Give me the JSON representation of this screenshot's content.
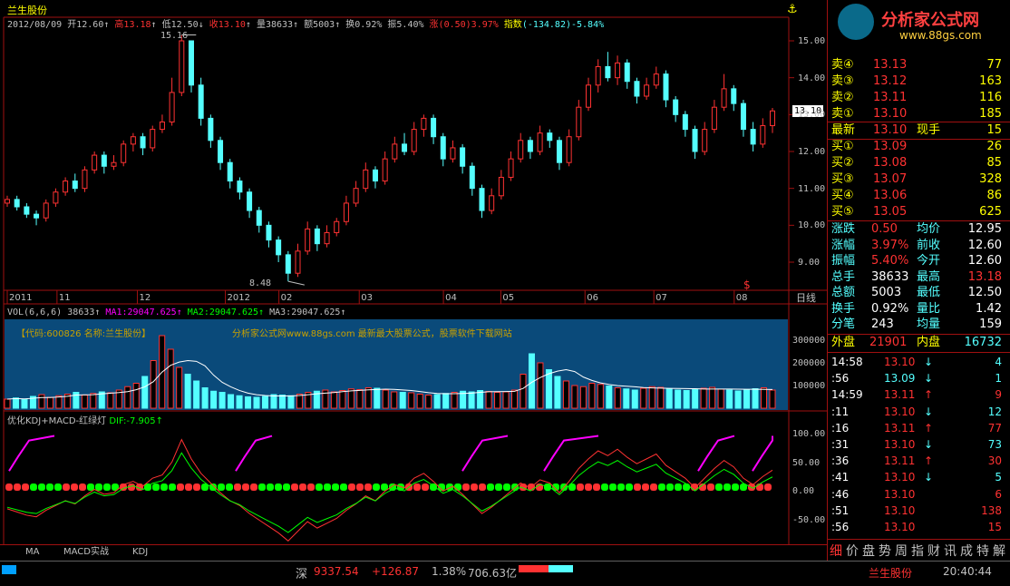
{
  "header": {
    "stock_name": "兰生股份",
    "date": "2012/08/09",
    "open_label": "开",
    "open_value": "12.60",
    "high_label": "高",
    "high_value": "13.18",
    "low_label": "低",
    "low_value": "12.50",
    "close_label": "收",
    "close_value": "13.10",
    "volume_label": "量",
    "volume_value": "38633",
    "amount_label": "额",
    "amount_value": "5003",
    "turnover_label": "换",
    "turnover_value": "0.92%",
    "amplitude_label": "振",
    "amplitude_value": "5.40%",
    "change_label": "涨",
    "change_value": "(0.50)3.97%",
    "index_label": "指数",
    "index_value": "(-134.82)-5.84%"
  },
  "price_chart": {
    "high_mark": "15.16",
    "low_mark": "8.48",
    "current_price_tag": "13.10",
    "y_ticks": [
      "15.00",
      "14.00",
      "13.00",
      "12.00",
      "11.00",
      "10.00",
      "9.00"
    ],
    "x_labels": [
      "2011",
      "11",
      "12",
      "2012",
      "02",
      "03",
      "04",
      "05",
      "06",
      "07",
      "08"
    ],
    "period_label": "日线",
    "candles": [
      {
        "o": 10.6,
        "c": 10.7,
        "h": 10.8,
        "l": 10.5
      },
      {
        "o": 10.7,
        "c": 10.5,
        "h": 10.8,
        "l": 10.4
      },
      {
        "o": 10.5,
        "c": 10.3,
        "h": 10.6,
        "l": 10.2
      },
      {
        "o": 10.3,
        "c": 10.2,
        "h": 10.4,
        "l": 10.0
      },
      {
        "o": 10.2,
        "c": 10.6,
        "h": 10.7,
        "l": 10.1
      },
      {
        "o": 10.6,
        "c": 10.9,
        "h": 11.0,
        "l": 10.5
      },
      {
        "o": 10.9,
        "c": 11.2,
        "h": 11.3,
        "l": 10.8
      },
      {
        "o": 11.2,
        "c": 11.0,
        "h": 11.4,
        "l": 10.9
      },
      {
        "o": 11.0,
        "c": 11.5,
        "h": 11.6,
        "l": 10.9
      },
      {
        "o": 11.5,
        "c": 11.9,
        "h": 12.0,
        "l": 11.4
      },
      {
        "o": 11.9,
        "c": 11.6,
        "h": 12.0,
        "l": 11.4
      },
      {
        "o": 11.6,
        "c": 11.7,
        "h": 11.9,
        "l": 11.5
      },
      {
        "o": 11.7,
        "c": 12.2,
        "h": 12.3,
        "l": 11.6
      },
      {
        "o": 12.2,
        "c": 12.4,
        "h": 12.5,
        "l": 12.0
      },
      {
        "o": 12.4,
        "c": 12.1,
        "h": 12.5,
        "l": 11.9
      },
      {
        "o": 12.1,
        "c": 12.6,
        "h": 12.7,
        "l": 12.0
      },
      {
        "o": 12.6,
        "c": 12.8,
        "h": 13.0,
        "l": 12.5
      },
      {
        "o": 12.8,
        "c": 13.6,
        "h": 14.0,
        "l": 12.7
      },
      {
        "o": 13.6,
        "c": 15.0,
        "h": 15.16,
        "l": 13.5
      },
      {
        "o": 15.0,
        "c": 13.8,
        "h": 15.0,
        "l": 13.6
      },
      {
        "o": 13.8,
        "c": 12.9,
        "h": 14.0,
        "l": 12.7
      },
      {
        "o": 12.9,
        "c": 12.3,
        "h": 13.0,
        "l": 12.1
      },
      {
        "o": 12.3,
        "c": 11.7,
        "h": 12.4,
        "l": 11.5
      },
      {
        "o": 11.7,
        "c": 11.2,
        "h": 11.8,
        "l": 11.0
      },
      {
        "o": 11.2,
        "c": 10.9,
        "h": 11.3,
        "l": 10.7
      },
      {
        "o": 10.9,
        "c": 10.4,
        "h": 11.0,
        "l": 10.2
      },
      {
        "o": 10.4,
        "c": 10.0,
        "h": 10.5,
        "l": 9.8
      },
      {
        "o": 10.0,
        "c": 9.6,
        "h": 10.1,
        "l": 9.4
      },
      {
        "o": 9.6,
        "c": 9.2,
        "h": 9.7,
        "l": 9.0
      },
      {
        "o": 9.2,
        "c": 8.7,
        "h": 9.3,
        "l": 8.48
      },
      {
        "o": 8.7,
        "c": 9.3,
        "h": 9.5,
        "l": 8.6
      },
      {
        "o": 9.3,
        "c": 9.9,
        "h": 10.1,
        "l": 9.2
      },
      {
        "o": 9.9,
        "c": 9.5,
        "h": 10.0,
        "l": 9.3
      },
      {
        "o": 9.5,
        "c": 9.8,
        "h": 10.0,
        "l": 9.4
      },
      {
        "o": 9.8,
        "c": 10.1,
        "h": 10.2,
        "l": 9.7
      },
      {
        "o": 10.1,
        "c": 10.6,
        "h": 10.8,
        "l": 10.0
      },
      {
        "o": 10.6,
        "c": 11.0,
        "h": 11.2,
        "l": 10.5
      },
      {
        "o": 11.0,
        "c": 11.5,
        "h": 11.7,
        "l": 10.9
      },
      {
        "o": 11.5,
        "c": 11.2,
        "h": 11.6,
        "l": 11.0
      },
      {
        "o": 11.2,
        "c": 11.8,
        "h": 12.0,
        "l": 11.1
      },
      {
        "o": 11.8,
        "c": 12.2,
        "h": 12.4,
        "l": 11.7
      },
      {
        "o": 12.2,
        "c": 12.0,
        "h": 12.5,
        "l": 11.9
      },
      {
        "o": 12.0,
        "c": 12.6,
        "h": 12.8,
        "l": 11.9
      },
      {
        "o": 12.6,
        "c": 12.9,
        "h": 13.0,
        "l": 12.4
      },
      {
        "o": 12.9,
        "c": 12.4,
        "h": 13.0,
        "l": 12.2
      },
      {
        "o": 12.4,
        "c": 11.8,
        "h": 12.5,
        "l": 11.6
      },
      {
        "o": 11.8,
        "c": 12.1,
        "h": 12.3,
        "l": 11.7
      },
      {
        "o": 12.1,
        "c": 11.6,
        "h": 12.2,
        "l": 11.4
      },
      {
        "o": 11.6,
        "c": 11.0,
        "h": 11.7,
        "l": 10.8
      },
      {
        "o": 11.0,
        "c": 10.4,
        "h": 11.1,
        "l": 10.2
      },
      {
        "o": 10.4,
        "c": 10.8,
        "h": 11.0,
        "l": 10.3
      },
      {
        "o": 10.8,
        "c": 11.3,
        "h": 11.5,
        "l": 10.7
      },
      {
        "o": 11.3,
        "c": 11.8,
        "h": 12.0,
        "l": 11.2
      },
      {
        "o": 11.8,
        "c": 12.3,
        "h": 12.5,
        "l": 11.7
      },
      {
        "o": 12.3,
        "c": 12.0,
        "h": 12.4,
        "l": 11.8
      },
      {
        "o": 12.0,
        "c": 12.5,
        "h": 12.7,
        "l": 11.9
      },
      {
        "o": 12.5,
        "c": 12.3,
        "h": 12.6,
        "l": 12.1
      },
      {
        "o": 12.3,
        "c": 11.7,
        "h": 12.4,
        "l": 11.5
      },
      {
        "o": 11.7,
        "c": 12.4,
        "h": 12.6,
        "l": 11.6
      },
      {
        "o": 12.4,
        "c": 13.2,
        "h": 13.4,
        "l": 12.3
      },
      {
        "o": 13.2,
        "c": 13.8,
        "h": 14.0,
        "l": 13.1
      },
      {
        "o": 13.8,
        "c": 14.3,
        "h": 14.5,
        "l": 13.6
      },
      {
        "o": 14.3,
        "c": 14.0,
        "h": 14.7,
        "l": 13.9
      },
      {
        "o": 14.0,
        "c": 14.4,
        "h": 14.6,
        "l": 13.8
      },
      {
        "o": 14.4,
        "c": 13.9,
        "h": 14.5,
        "l": 13.7
      },
      {
        "o": 13.9,
        "c": 13.5,
        "h": 14.0,
        "l": 13.3
      },
      {
        "o": 13.5,
        "c": 13.8,
        "h": 14.0,
        "l": 13.4
      },
      {
        "o": 13.8,
        "c": 14.1,
        "h": 14.3,
        "l": 13.7
      },
      {
        "o": 14.1,
        "c": 13.4,
        "h": 14.2,
        "l": 13.2
      },
      {
        "o": 13.4,
        "c": 13.0,
        "h": 13.5,
        "l": 12.8
      },
      {
        "o": 13.0,
        "c": 12.6,
        "h": 13.1,
        "l": 12.4
      },
      {
        "o": 12.6,
        "c": 12.0,
        "h": 12.7,
        "l": 11.8
      },
      {
        "o": 12.0,
        "c": 12.6,
        "h": 12.8,
        "l": 11.9
      },
      {
        "o": 12.6,
        "c": 13.2,
        "h": 13.4,
        "l": 12.5
      },
      {
        "o": 13.2,
        "c": 13.7,
        "h": 14.1,
        "l": 13.1
      },
      {
        "o": 13.7,
        "c": 13.3,
        "h": 13.8,
        "l": 13.1
      },
      {
        "o": 13.3,
        "c": 12.6,
        "h": 13.4,
        "l": 12.4
      },
      {
        "o": 12.6,
        "c": 12.2,
        "h": 12.8,
        "l": 12.0
      },
      {
        "o": 12.2,
        "c": 12.7,
        "h": 12.9,
        "l": 12.1
      },
      {
        "o": 12.7,
        "c": 13.1,
        "h": 13.18,
        "l": 12.5
      }
    ]
  },
  "volume_panel": {
    "title": "VOL(6,6,6)",
    "vol_value": "38633",
    "ma1": "MA1:29047.625",
    "ma2": "MA2:29047.625",
    "ma3": "MA3:29047.625",
    "info_code": "【代码:600826  名称:兰生股份】",
    "watermark": "分析家公式网www.88gs.com 最新最大股票公式，股票软件下载网站",
    "y_ticks": [
      "300000",
      "200000",
      "100000"
    ],
    "values": [
      40,
      45,
      38,
      52,
      60,
      48,
      55,
      62,
      70,
      58,
      65,
      72,
      68,
      80,
      95,
      110,
      140,
      210,
      320,
      260,
      180,
      150,
      120,
      90,
      75,
      70,
      60,
      55,
      50,
      48,
      52,
      60,
      58,
      55,
      62,
      70,
      75,
      80,
      72,
      78,
      85,
      82,
      90,
      88,
      80,
      72,
      70,
      68,
      62,
      58,
      60,
      65,
      70,
      75,
      72,
      78,
      74,
      70,
      72,
      80,
      150,
      240,
      200,
      170,
      140,
      120,
      100,
      95,
      110,
      105,
      98,
      90,
      85,
      80,
      88,
      95,
      92,
      86,
      80,
      78,
      84,
      88,
      92,
      84,
      80,
      76,
      82,
      86,
      90,
      80
    ]
  },
  "indicator_panel": {
    "title": "优化KDJ+MACD-红绿灯",
    "dif_label": "DIF:-7.905",
    "y_ticks": [
      "100.00",
      "50.00",
      "0.00",
      "-50.00"
    ]
  },
  "bottom_tabs": [
    "MA",
    "MACD实战",
    "KDJ"
  ],
  "logo": {
    "brand": "分析家公式网",
    "url": "www.88gs.com"
  },
  "quote": {
    "sell_rows": [
      {
        "label": "卖④",
        "price": "13.13",
        "vol": "77"
      },
      {
        "label": "卖③",
        "price": "13.12",
        "vol": "163"
      },
      {
        "label": "卖②",
        "price": "13.11",
        "vol": "116"
      },
      {
        "label": "卖①",
        "price": "13.10",
        "vol": "185"
      }
    ],
    "latest_label": "最新",
    "latest_price": "13.10",
    "now_label": "现手",
    "now_vol": "15",
    "buy_rows": [
      {
        "label": "买①",
        "price": "13.09",
        "vol": "26"
      },
      {
        "label": "买②",
        "price": "13.08",
        "vol": "85"
      },
      {
        "label": "买③",
        "price": "13.07",
        "vol": "328"
      },
      {
        "label": "买④",
        "price": "13.06",
        "vol": "86"
      },
      {
        "label": "买⑤",
        "price": "13.05",
        "vol": "625"
      }
    ],
    "stats": [
      {
        "l1": "涨跌",
        "v1": "0.50",
        "l2": "均价",
        "v2": "12.95"
      },
      {
        "l1": "涨幅",
        "v1": "3.97%",
        "l2": "前收",
        "v2": "12.60"
      },
      {
        "l1": "振幅",
        "v1": "5.40%",
        "l2": "今开",
        "v2": "12.60"
      },
      {
        "l1": "总手",
        "v1": "38633",
        "l2": "最高",
        "v2": "13.18"
      },
      {
        "l1": "总额",
        "v1": "5003",
        "l2": "最低",
        "v2": "12.50"
      },
      {
        "l1": "换手",
        "v1": "0.92%",
        "l2": "量比",
        "v2": "1.42"
      },
      {
        "l1": "分笔",
        "v1": "243",
        "l2": "均量",
        "v2": "159"
      }
    ],
    "outer_label": "外盘",
    "outer_value": "21901",
    "inner_label": "内盘",
    "inner_value": "16732"
  },
  "ticks": [
    {
      "time": "14:58",
      "price": "13.10",
      "dir": "down",
      "vol": "4"
    },
    {
      "time": ":56",
      "price": "13.09",
      "dir": "down",
      "vol": "1"
    },
    {
      "time": "14:59",
      "price": "13.11",
      "dir": "up",
      "vol": "9"
    },
    {
      "time": ":11",
      "price": "13.10",
      "dir": "down",
      "vol": "12"
    },
    {
      "time": ":16",
      "price": "13.11",
      "dir": "up",
      "vol": "77"
    },
    {
      "time": ":31",
      "price": "13.10",
      "dir": "down",
      "vol": "73"
    },
    {
      "time": ":36",
      "price": "13.11",
      "dir": "up",
      "vol": "30"
    },
    {
      "time": ":41",
      "price": "13.10",
      "dir": "down",
      "vol": "5"
    },
    {
      "time": ":46",
      "price": "13.10",
      "dir": "",
      "vol": "6"
    },
    {
      "time": ":51",
      "price": "13.10",
      "dir": "",
      "vol": "138"
    },
    {
      "time": ":56",
      "price": "13.10",
      "dir": "",
      "vol": "15"
    }
  ],
  "right_tabs": [
    "细",
    "价",
    "盘",
    "势",
    "周",
    "指",
    "财",
    "讯",
    "成",
    "特",
    "解"
  ],
  "status_bar": {
    "market_label": "深",
    "index_value": "9337.54",
    "index_change": "+126.87",
    "index_pct": "1.38%",
    "amount": "706.63亿",
    "stock_name": "兰生股份",
    "time": "20:40:44"
  },
  "colors": {
    "up": "#ff3232",
    "down": "#54ffff",
    "label_yellow": "#ffff00",
    "magenta": "#ff00ff",
    "green": "#00ff00",
    "frame": "#a01010"
  }
}
